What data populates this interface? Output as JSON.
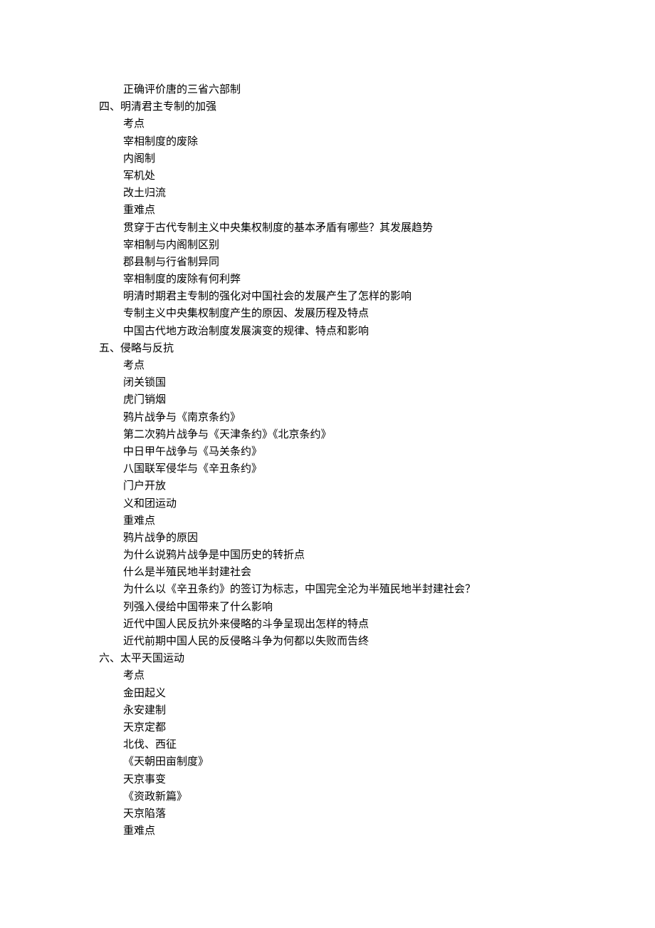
{
  "document": {
    "lines": [
      {
        "type": "item",
        "text": "正确评价唐的三省六部制"
      },
      {
        "type": "heading",
        "text": "四、明清君主专制的加强"
      },
      {
        "type": "item",
        "text": "考点"
      },
      {
        "type": "item",
        "text": "宰相制度的废除"
      },
      {
        "type": "item",
        "text": "内阁制"
      },
      {
        "type": "item",
        "text": "军机处"
      },
      {
        "type": "item",
        "text": "改土归流"
      },
      {
        "type": "item",
        "text": "重难点"
      },
      {
        "type": "item",
        "text": "贯穿于古代专制主义中央集权制度的基本矛盾有哪些？其发展趋势"
      },
      {
        "type": "item",
        "text": "宰相制与内阁制区别"
      },
      {
        "type": "item",
        "text": "郡县制与行省制异同"
      },
      {
        "type": "item",
        "text": "宰相制度的废除有何利弊"
      },
      {
        "type": "item",
        "text": "明清时期君主专制的强化对中国社会的发展产生了怎样的影响"
      },
      {
        "type": "item",
        "text": "专制主义中央集权制度产生的原因、发展历程及特点"
      },
      {
        "type": "item",
        "text": "中国古代地方政治制度发展演变的规律、特点和影响"
      },
      {
        "type": "heading",
        "text": "五、侵略与反抗"
      },
      {
        "type": "item",
        "text": "考点"
      },
      {
        "type": "item",
        "text": "闭关锁国"
      },
      {
        "type": "item",
        "text": "虎门销烟"
      },
      {
        "type": "item",
        "text": "鸦片战争与《南京条约》"
      },
      {
        "type": "item",
        "text": "第二次鸦片战争与《天津条约》《北京条约》"
      },
      {
        "type": "item",
        "text": "中日甲午战争与《马关条约》"
      },
      {
        "type": "item",
        "text": "八国联军侵华与《辛丑条约》"
      },
      {
        "type": "item",
        "text": "门户开放"
      },
      {
        "type": "item",
        "text": "义和团运动"
      },
      {
        "type": "item",
        "text": "重难点"
      },
      {
        "type": "item",
        "text": "鸦片战争的原因"
      },
      {
        "type": "item",
        "text": "为什么说鸦片战争是中国历史的转折点"
      },
      {
        "type": "item",
        "text": "什么是半殖民地半封建社会"
      },
      {
        "type": "item",
        "text": "为什么以《辛丑条约》的签订为标志，中国完全沦为半殖民地半封建社会？"
      },
      {
        "type": "item",
        "text": "列强入侵给中国带来了什么影响"
      },
      {
        "type": "item",
        "text": "近代中国人民反抗外来侵略的斗争呈现出怎样的特点"
      },
      {
        "type": "item",
        "text": "近代前期中国人民的反侵略斗争为何都以失败而告终"
      },
      {
        "type": "heading",
        "text": "六、太平天国运动"
      },
      {
        "type": "item",
        "text": "考点"
      },
      {
        "type": "item",
        "text": "金田起义"
      },
      {
        "type": "item",
        "text": "永安建制"
      },
      {
        "type": "item",
        "text": "天京定都"
      },
      {
        "type": "item",
        "text": "北伐、西征"
      },
      {
        "type": "item",
        "text": "《天朝田亩制度》"
      },
      {
        "type": "item",
        "text": "天京事变"
      },
      {
        "type": "item",
        "text": "《资政新篇》"
      },
      {
        "type": "item",
        "text": "天京陷落"
      },
      {
        "type": "item",
        "text": "重难点"
      }
    ]
  }
}
